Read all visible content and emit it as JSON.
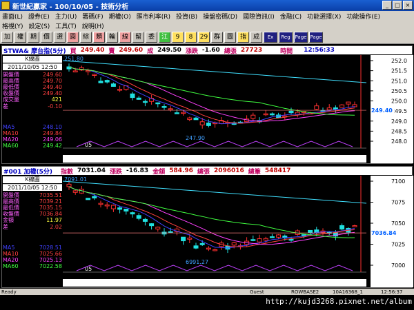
{
  "window": {
    "title": "新世紀贏家 - 100/10/05 - 技術分析"
  },
  "menu": {
    "row1": [
      "畫面(L)",
      "證券(E)",
      "主力(U)",
      "籌碼(F)",
      "期權(O)",
      "匯市利率(R)",
      "投資(B)",
      "操盤密碼(D)",
      "國際資訊(I)",
      "金融(C)",
      "功能選擇(X)",
      "功能操作(E)"
    ],
    "row2": [
      "格視(Y)",
      "設定(S)",
      "工具(T)",
      "說明(H)"
    ]
  },
  "toolbar": {
    "buttons": [
      "加",
      "權",
      "期",
      "價",
      "選",
      "圓",
      "綜",
      "類",
      "輪",
      "線",
      "留",
      "委",
      "江",
      "9",
      "8",
      "29",
      "群",
      "圖",
      "指",
      "成"
    ],
    "icons": [
      "Ex",
      "Reg",
      "Page",
      "Page"
    ]
  },
  "top": {
    "header": {
      "symbol": "STWA& 摩台指(5分)",
      "buy_label": "買",
      "buy": "249.40",
      "sell_label": "賣",
      "sell": "249.60",
      "deal_label": "成",
      "deal": "249.50",
      "chg_label": "漲跌",
      "chg": "-1.60",
      "vol_label": "總張",
      "vol": "27723",
      "time_label": "時間",
      "time": "12:56:33"
    },
    "kline_label": "K線圖",
    "date": "2011/10/05 12:50",
    "info": [
      {
        "k": "開盤價",
        "v": "249.60"
      },
      {
        "k": "最高價",
        "v": "249.70"
      },
      {
        "k": "最低價",
        "v": "249.40"
      },
      {
        "k": "收盤價",
        "v": "249.40"
      },
      {
        "k": "成交量",
        "v": "421"
      },
      {
        "k": "差",
        "v": "-0.10"
      }
    ],
    "ma": [
      {
        "k": "MA5",
        "v": "248.10",
        "color": "#4040ff"
      },
      {
        "k": "MA10",
        "v": "249.84",
        "color": "#ff4040"
      },
      {
        "k": "MA20",
        "v": "249.06",
        "color": "#ff40ff"
      },
      {
        "k": "MA60",
        "v": "249.42",
        "color": "#40ff40"
      }
    ],
    "axis": [
      "252.0",
      "251.5",
      "251.0",
      "250.5",
      "250.0",
      "249.5",
      "249.0",
      "248.5",
      "248.0"
    ],
    "high_label": "251.80",
    "low_label": "247.90",
    "cur_label": "249.40",
    "xlabel": "05"
  },
  "bottom": {
    "header": {
      "symbol": "#001 加權(5分)",
      "idx_label": "指數",
      "idx": "7031.04",
      "chg_label": "漲跌",
      "chg": "-16.83",
      "amt_label": "金額",
      "amt": "584.96",
      "vol_label": "總張",
      "vol": "2096016",
      "cnt_label": "總筆",
      "cnt": "548417"
    },
    "kline_label": "K線圖",
    "date": "2011/10/05 12:50",
    "info": [
      {
        "k": "開盤價",
        "v": "7035.51"
      },
      {
        "k": "最高價",
        "v": "7039.21"
      },
      {
        "k": "最低價",
        "v": "7035.15"
      },
      {
        "k": "收盤價",
        "v": "7036.84"
      },
      {
        "k": "金額",
        "v": "11.97"
      },
      {
        "k": "差",
        "v": "2.02"
      }
    ],
    "ma": [
      {
        "k": "MA5",
        "v": "7028.51",
        "color": "#4040ff"
      },
      {
        "k": "MA10",
        "v": "7025.66",
        "color": "#ff4040"
      },
      {
        "k": "MA20",
        "v": "7025.13",
        "color": "#ff40ff"
      },
      {
        "k": "MA60",
        "v": "7022.58",
        "color": "#40ff40"
      }
    ],
    "axis": [
      "7100",
      "7075",
      "7050",
      "7025",
      "7000"
    ],
    "high_label": "7091.01",
    "low_label": "6991.27",
    "cur_label": "7036.84",
    "xlabel": "05"
  },
  "status": {
    "left": "Ready",
    "mid1": "Guest",
    "mid2": "ROWBASE2",
    "mid3": "10A16368_1",
    "time": "12:56:37"
  },
  "url": "http://kujd3268.pixnet.net/album"
}
